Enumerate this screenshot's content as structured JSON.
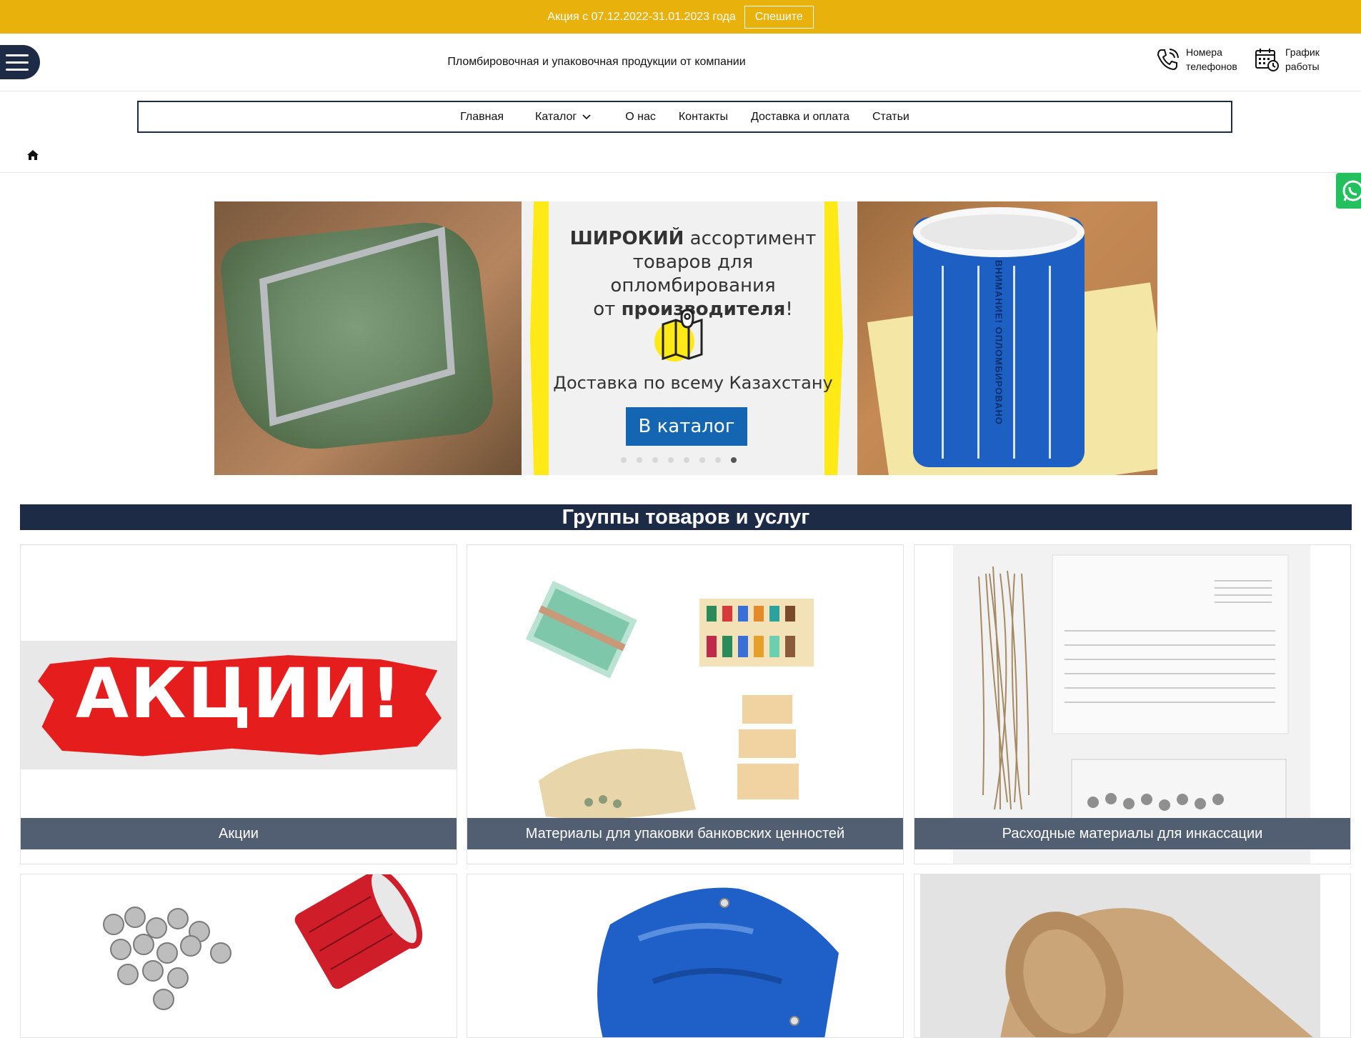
{
  "promo": {
    "text": "Акция с 07.12.2022-31.01.2023 года",
    "button": "Спешите",
    "bg": "#e9b10c"
  },
  "header": {
    "tagline": "Пломбировочная и упаковочная продукции от компании",
    "phones_line1": "Номера",
    "phones_line2": "телефонов",
    "schedule_line1": "График",
    "schedule_line2": "работы"
  },
  "nav": {
    "items": [
      "Главная",
      "Каталог",
      "О нас",
      "Контакты",
      "Доставка и оплата",
      "Статьи"
    ]
  },
  "banner": {
    "title_line1_bold": "ШИРОКИЙ",
    "title_line1_rest": " ассортимент",
    "title_line2": "товаров для опломбирования",
    "title_line3_pre": "от ",
    "title_line3_bold": "производителя",
    "title_line3_end": "!",
    "delivery": "Доставка по всему Казахстану",
    "button": "В каталог",
    "slide_count": 8,
    "active_slide": 8,
    "label_text": "ВНИМАНИЕ! ОПЛОМБИРОВАНО"
  },
  "section": {
    "title": "Группы товаров и услуг",
    "bg": "#1e2b46"
  },
  "products": [
    {
      "label": "Акции",
      "image_text": "АКЦИИ!"
    },
    {
      "label": "Материалы для упаковки банковских ценностей"
    },
    {
      "label": "Расходные материалы для инкассации"
    }
  ],
  "colors": {
    "accent_yellow": "#ffe916",
    "button_blue": "#1566b2",
    "label_bar": "#525f73",
    "whatsapp": "#22c15e"
  }
}
